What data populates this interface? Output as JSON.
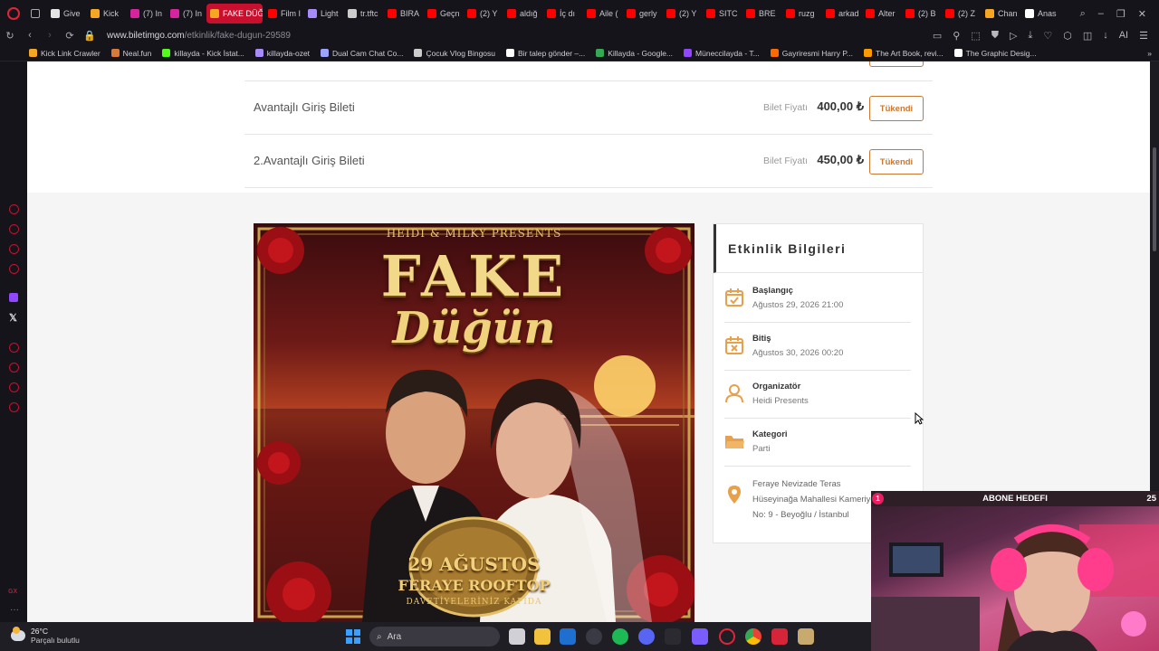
{
  "tabs": [
    {
      "label": "Give",
      "color": "#e5e5e5"
    },
    {
      "label": "Kick",
      "color": "#f5a623"
    },
    {
      "label": "(7) In",
      "color": "#d6249f"
    },
    {
      "label": "(7) In",
      "color": "#d6249f"
    },
    {
      "label": "FAKE DÜĞ",
      "color": "#f5a623",
      "active": true
    },
    {
      "label": "Film I",
      "color": "#ff0000"
    },
    {
      "label": "Light",
      "color": "#a78bfa"
    },
    {
      "label": "tr.tftc",
      "color": "#cccccc"
    },
    {
      "label": "BIRA",
      "color": "#ff0000"
    },
    {
      "label": "Geçn",
      "color": "#ff0000"
    },
    {
      "label": "(2) Y",
      "color": "#ff0000"
    },
    {
      "label": "aldığ",
      "color": "#ff0000"
    },
    {
      "label": "İç dı",
      "color": "#ff0000"
    },
    {
      "label": "Aile (",
      "color": "#ff0000"
    },
    {
      "label": "gerly",
      "color": "#ff0000"
    },
    {
      "label": "(2) Y",
      "color": "#ff0000"
    },
    {
      "label": "SITC",
      "color": "#ff0000"
    },
    {
      "label": "BRE",
      "color": "#ff0000"
    },
    {
      "label": "ruzg",
      "color": "#ff0000"
    },
    {
      "label": "arkad",
      "color": "#ff0000"
    },
    {
      "label": "Alter",
      "color": "#ff0000"
    },
    {
      "label": "(2) B",
      "color": "#ff0000"
    },
    {
      "label": "(2) Z",
      "color": "#ff0000"
    },
    {
      "label": "Chan",
      "color": "#f5a623"
    },
    {
      "label": "Anas",
      "color": "#ffffff"
    }
  ],
  "address": {
    "host": "www.biletimgo.com",
    "path": "/etkinlik/fake-dugun-29589"
  },
  "bookmarks": [
    {
      "label": "Kick Link Crawler",
      "color": "#f5a623"
    },
    {
      "label": "Neal.fun",
      "color": "#d97a3a"
    },
    {
      "label": "killayda - Kick İstat...",
      "color": "#53fc18"
    },
    {
      "label": "killayda-ozet",
      "color": "#a78bfa"
    },
    {
      "label": "Dual Cam Chat Co...",
      "color": "#9aa4ff"
    },
    {
      "label": "Çocuk Vlog Bingosu",
      "color": "#cccccc"
    },
    {
      "label": "Bir talep gönder –...",
      "color": "#ffffff"
    },
    {
      "label": "Killayda - Google...",
      "color": "#34a853"
    },
    {
      "label": "Müneccilayda - T...",
      "color": "#9146ff"
    },
    {
      "label": "Gayriresmi Harry P...",
      "color": "#ff6a00"
    },
    {
      "label": "The Art Book, revi...",
      "color": "#ff9900"
    },
    {
      "label": "The Graphic Desig...",
      "color": "#ffffff"
    }
  ],
  "tickets": [
    {
      "name": "Avantajlı Giriş Bileti",
      "price_label": "Bilet Fiyatı",
      "price": "400,00 ₺",
      "button": "Tükendi"
    },
    {
      "name": "2.Avantajlı Giriş Bileti",
      "price_label": "Bilet Fiyatı",
      "price": "450,00 ₺",
      "button": "Tükendi"
    }
  ],
  "poster": {
    "presents": "HEIDI & MILKY PRESENTS",
    "title_1": "FAKE",
    "title_2": "Düğün",
    "date": "29 AĞUSTOS",
    "venue": "FERAYE ROOFTOP",
    "invite": "DAVETİYELERİNİZ KAPIDA"
  },
  "info": {
    "title": "Etkinlik Bilgileri",
    "items": [
      {
        "label": "Başlangıç",
        "value": "Ağustos 29, 2026 21:00",
        "icon": "calendar-check-icon"
      },
      {
        "label": "Bitiş",
        "value": "Ağustos 30, 2026 00:20",
        "icon": "calendar-x-icon"
      },
      {
        "label": "Organizatör",
        "value": "Heidi Presents",
        "icon": "user-icon"
      },
      {
        "label": "Kategori",
        "value": "Parti",
        "icon": "folder-icon"
      }
    ],
    "location": {
      "name": "Feraye Nevizade Teras",
      "line1": "Hüseyinağa Mahallesi Kameriye",
      "line2": "No: 9 - Beyoğlu / İstanbul",
      "icon": "map-pin-icon"
    },
    "accent": "#e8a04a"
  },
  "overlay": {
    "badge": "1",
    "title": "ABONE HEDEFI",
    "count": "25"
  },
  "taskbar": {
    "temp": "26°C",
    "weather": "Parçalı bulutlu",
    "search": "Ara"
  }
}
